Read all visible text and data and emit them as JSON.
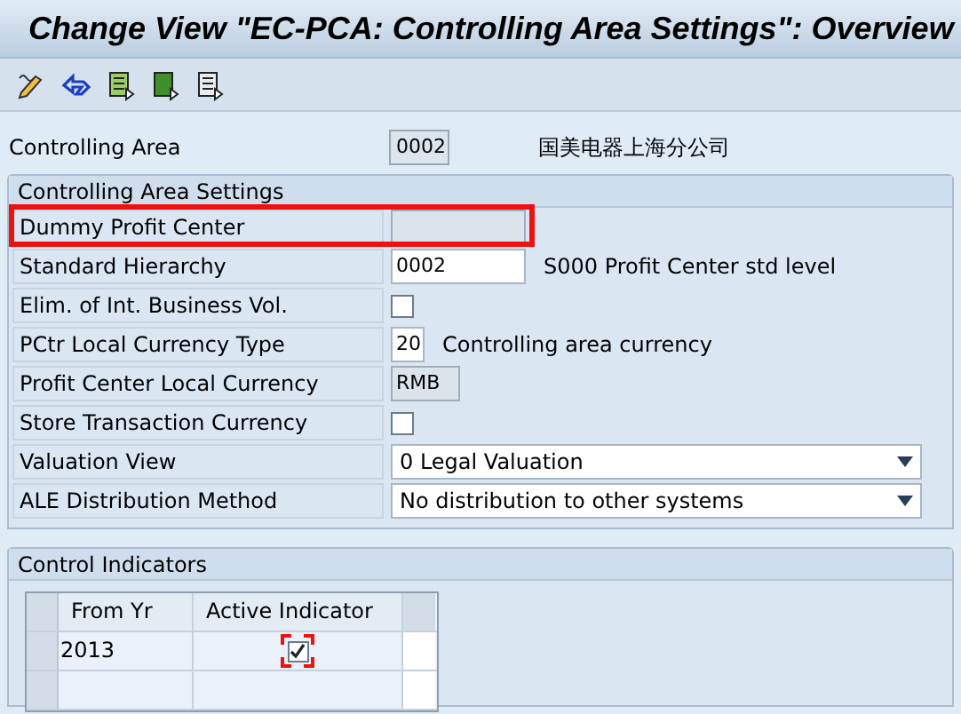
{
  "window": {
    "title": "Change View \"EC-PCA: Controlling Area Settings\": Overview"
  },
  "toolbar": {
    "icons": [
      {
        "kind": "edit"
      },
      {
        "kind": "undo"
      },
      {
        "kind": "green"
      },
      {
        "kind": "darkgreen"
      },
      {
        "kind": "grey"
      }
    ]
  },
  "header_field": {
    "label": "Controlling Area",
    "value": "0002",
    "description": "国美电器上海分公司"
  },
  "settings": {
    "title": "Controlling Area Settings",
    "rows": [
      {
        "kind": "text",
        "label": "Dummy Profit Center",
        "editable": false,
        "highlighted": true
      },
      {
        "kind": "text",
        "label": "Standard Hierarchy",
        "value": "0002",
        "editable": true,
        "description": "S000 Profit Center std level"
      },
      {
        "kind": "checkbox",
        "label": "Elim. of Int. Business Vol.",
        "checked": false
      },
      {
        "kind": "text",
        "label": "PCtr Local Currency Type",
        "value": "20",
        "editable": true,
        "description": "Controlling area currency"
      },
      {
        "kind": "text",
        "label": "Profit Center Local Currency",
        "value": "RMB",
        "editable": false
      },
      {
        "kind": "checkbox",
        "label": "Store Transaction Currency",
        "checked": false
      },
      {
        "kind": "dropdown",
        "label": "Valuation View",
        "value": "0 Legal Valuation"
      },
      {
        "kind": "dropdown",
        "label": "ALE Distribution Method",
        "value": "No distribution to other systems"
      }
    ]
  },
  "control_indicators": {
    "title": "Control Indicators",
    "table": {
      "columns": [
        "From Yr",
        "Active Indicator"
      ],
      "rows": [
        {
          "from_yr": "2013",
          "active": true,
          "highlighted": true
        }
      ]
    }
  }
}
